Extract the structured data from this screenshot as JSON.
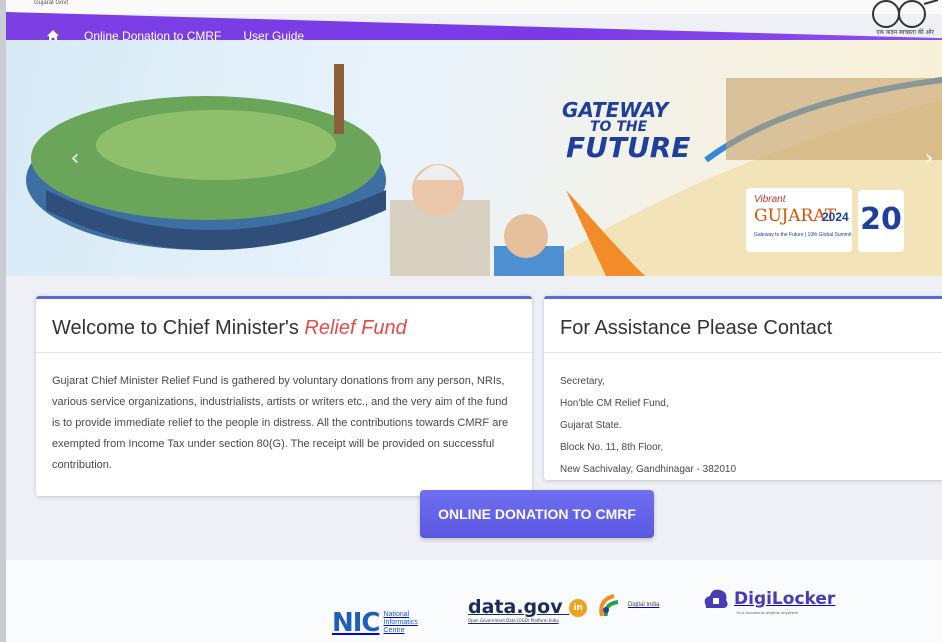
{
  "top": {
    "tag": "Gujarat Govt",
    "emblem_caption": "एक कदम स्वच्छता की ओर"
  },
  "nav": {
    "items": [
      "Online Donation to CMRF",
      "User Guide"
    ]
  },
  "banner": {
    "headline_1": "GATEWAY",
    "headline_2": "TO THE",
    "headline_3": "FUTURE",
    "vibrant": "Vibrant",
    "gujarat": "GUJARAT",
    "year": "2024",
    "summit_sub": "Gateway to the Future | 10th Global Summit",
    "twenty": "20",
    "arrow_left": "‹",
    "arrow_right": "›"
  },
  "welcome": {
    "title_prefix": "Welcome to Chief Minister's",
    "title_accent": "Relief Fund",
    "body": "Gujarat Chief Minister Relief Fund is gathered by voluntary donations from any person, NRIs, various service organizations, industrialists, artists or writers etc., and the very aim of the fund is to provide immediate relief to the people in distress. All the contributions towards CMRF are exempted from Income Tax under section 80(G). The receipt will be provided on successful contribution."
  },
  "contact": {
    "title": "For Assistance Please Contact",
    "lines": [
      "Secretary,",
      "Hon'ble CM Relief Fund,",
      "Gujarat State.",
      "Block No. 11, 8th Floor,",
      "New Sachivalay, Gandhinagar - 382010"
    ]
  },
  "donate_button": "ONLINE DONATION TO CMRF",
  "footer": {
    "nic_mark": "NIC",
    "nic_lines": [
      "National",
      "Informatics",
      "Centre"
    ],
    "datagov": "data.gov",
    "datagov_circle": "in",
    "datagov_sub": "Open Government Data (OGD) Platform India",
    "digital_india": "Digital India",
    "digilocker": "DigiLocker",
    "digilocker_sub": "Your documents anytime anywhere"
  },
  "colors": {
    "nav": "#7a3be6",
    "accent": "#e24b4b",
    "button": "#5b58e0"
  }
}
